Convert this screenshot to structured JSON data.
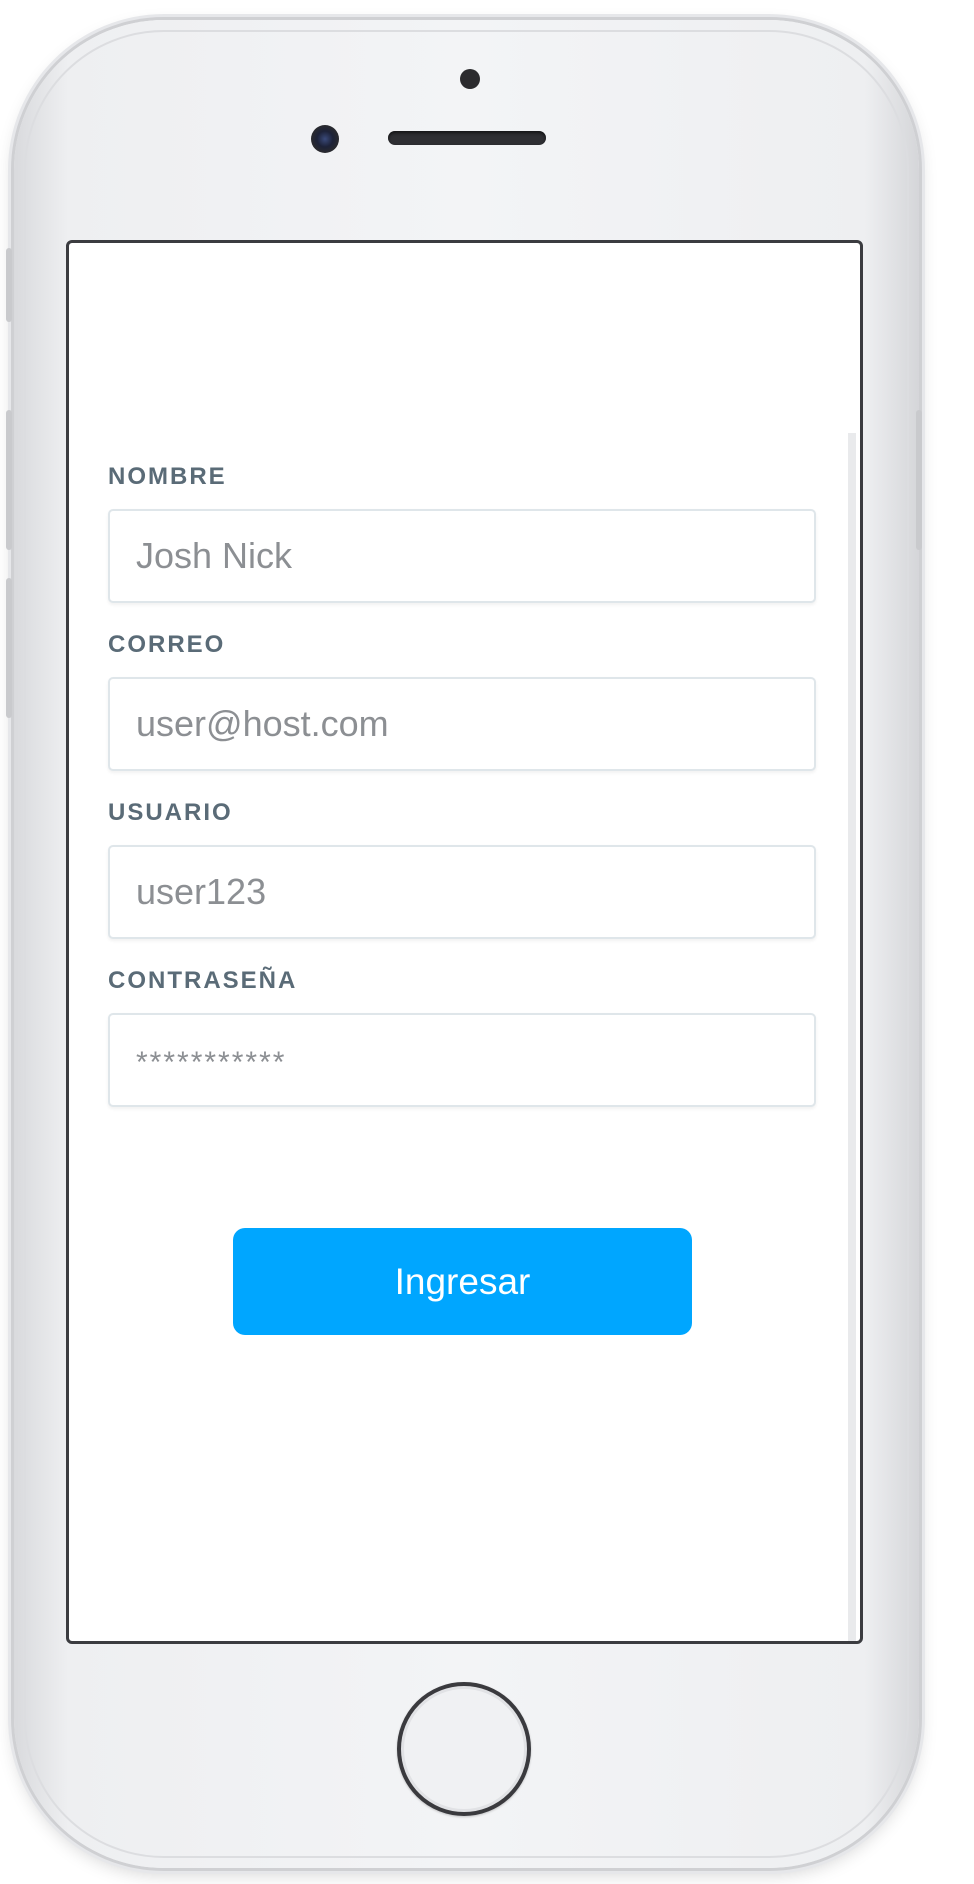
{
  "form": {
    "fields": [
      {
        "label": "NOMBRE",
        "placeholder": "Josh Nick",
        "type": "text"
      },
      {
        "label": "CORREO",
        "placeholder": "user@host.com",
        "type": "email"
      },
      {
        "label": "USUARIO",
        "placeholder": "user123",
        "type": "text"
      },
      {
        "label": "CONTRASEÑA",
        "placeholder": "***********",
        "type": "password"
      }
    ],
    "submit_label": "Ingresar"
  },
  "colors": {
    "accent": "#00a6ff",
    "label": "#5a6b77"
  },
  "icons": [
    "front-camera-icon",
    "speaker-grille-icon",
    "home-button-icon"
  ]
}
